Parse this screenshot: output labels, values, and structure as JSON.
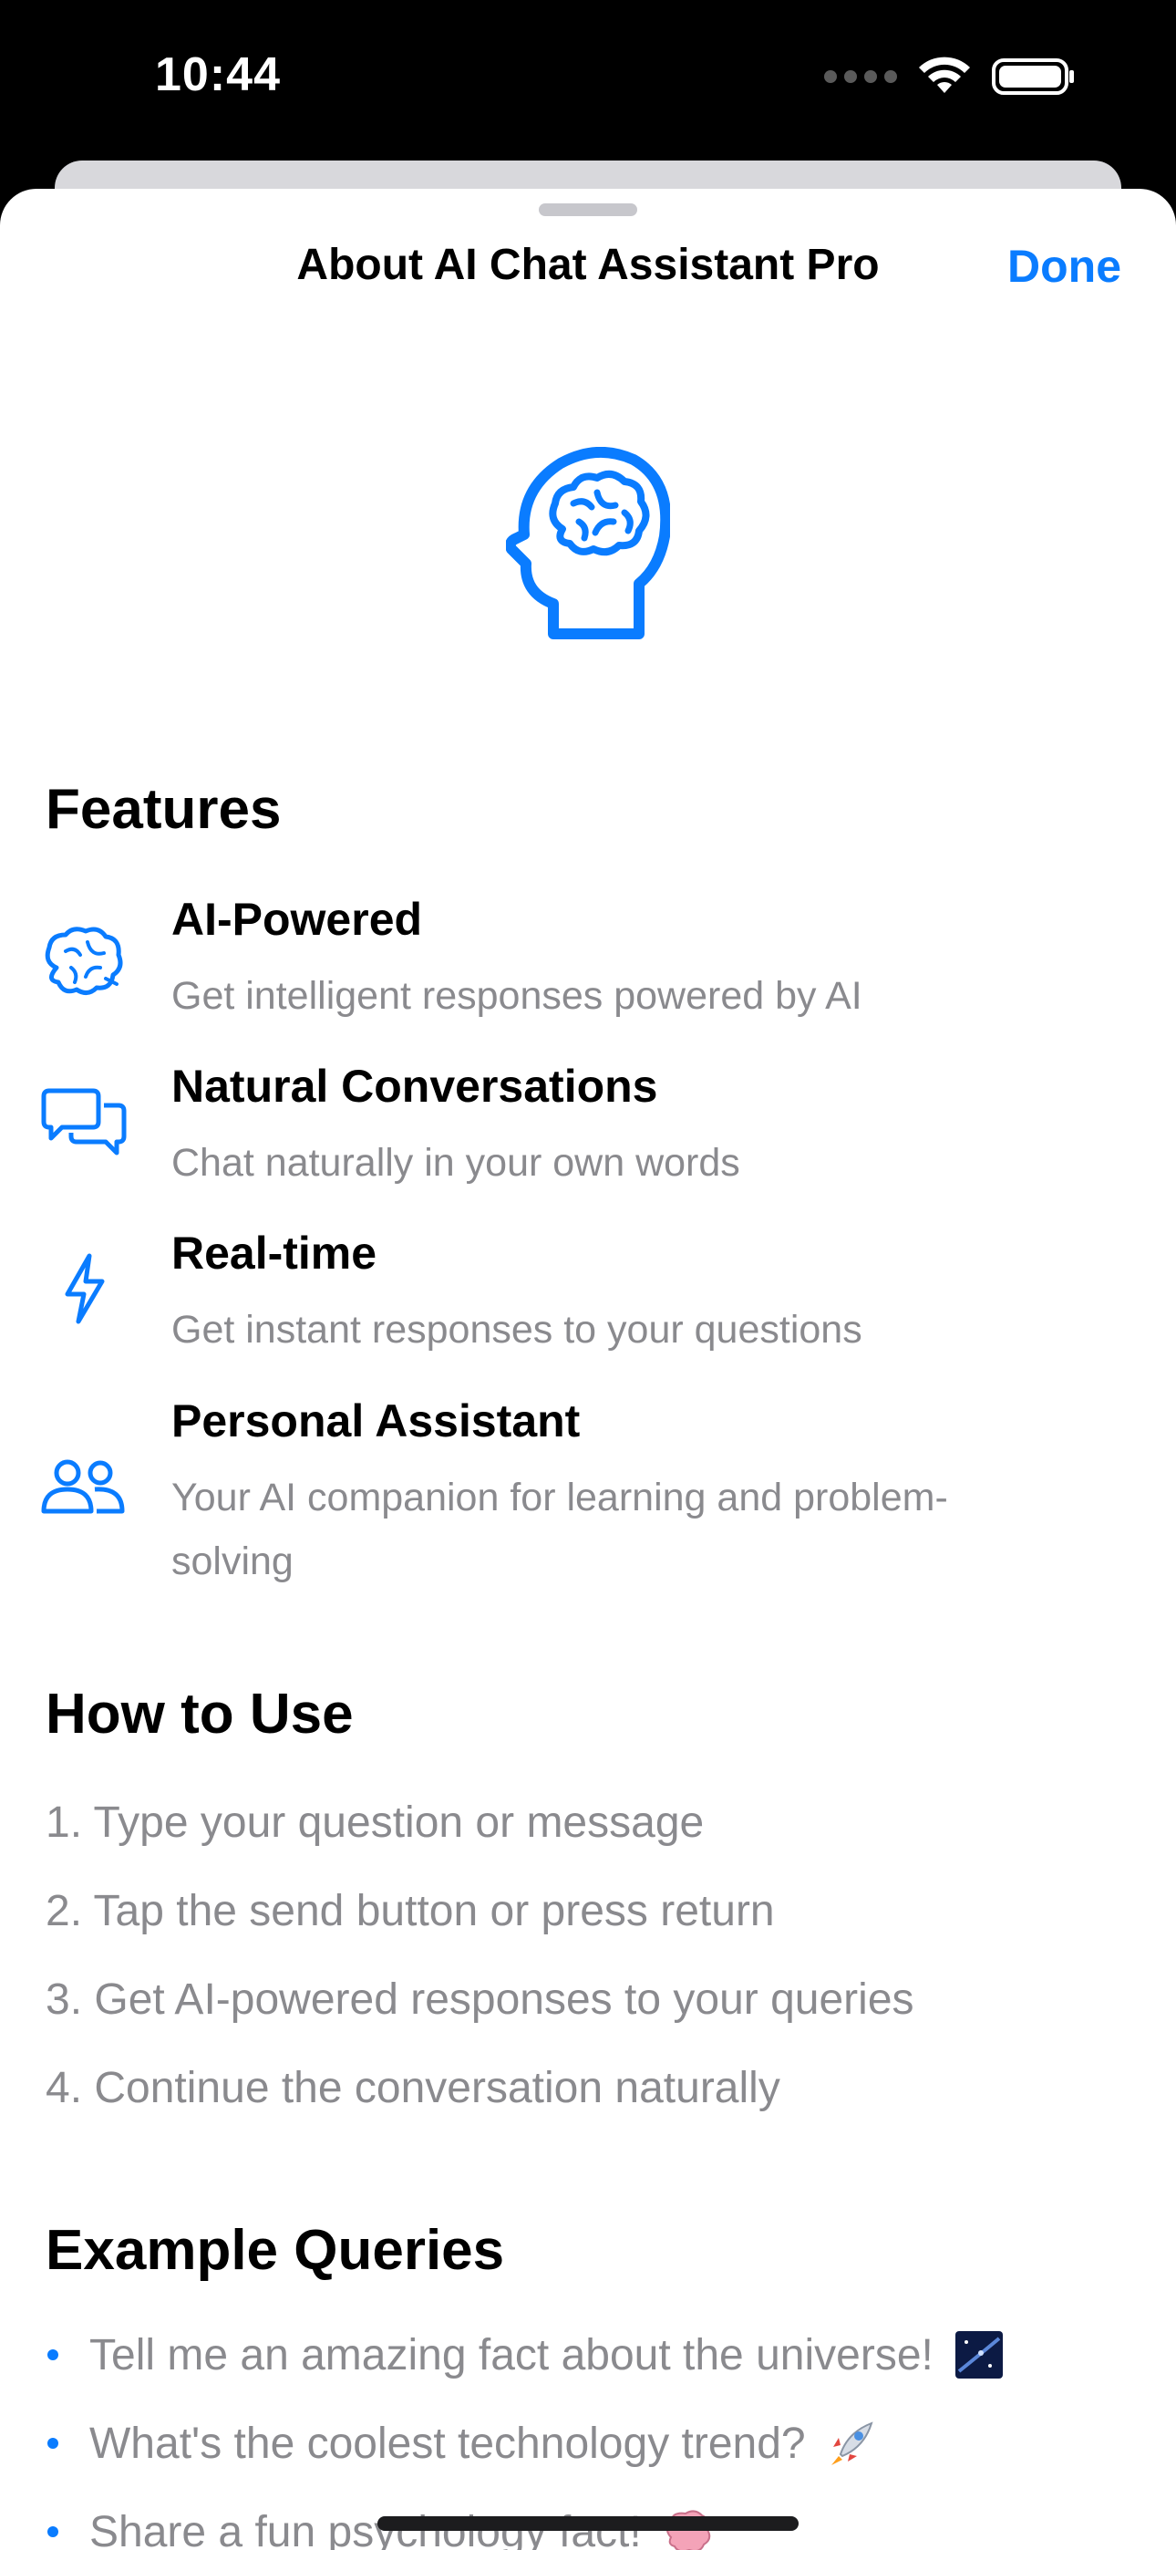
{
  "status_bar": {
    "time": "10:44"
  },
  "nav": {
    "title": "About AI Chat Assistant Pro",
    "done_label": "Done"
  },
  "colors": {
    "accent": "#0a7cff",
    "secondary_text": "#8a8a8e"
  },
  "features": {
    "title": "Features",
    "items": [
      {
        "icon": "brain-icon",
        "title": "AI-Powered",
        "description": "Get intelligent responses powered by AI"
      },
      {
        "icon": "chat-bubbles-icon",
        "title": "Natural Conversations",
        "description": "Chat naturally in your own words"
      },
      {
        "icon": "bolt-icon",
        "title": "Real-time",
        "description": "Get instant responses to your questions"
      },
      {
        "icon": "people-icon",
        "title": "Personal Assistant",
        "description": "Your AI companion for learning and problem-solving"
      }
    ]
  },
  "how_to_use": {
    "title": "How to Use",
    "steps": [
      "1. Type your question or message",
      "2. Tap the send button or press return",
      "3. Get AI-powered responses to your queries",
      "4. Continue the conversation naturally"
    ]
  },
  "example_queries": {
    "title": "Example Queries",
    "items": [
      {
        "text": "Tell me an amazing fact about the universe!",
        "emoji": "galaxy-emoji"
      },
      {
        "text": "What's the coolest technology trend?",
        "emoji": "rocket-emoji"
      },
      {
        "text": "Share a fun psychology fact!",
        "emoji": "brain-emoji"
      }
    ]
  }
}
